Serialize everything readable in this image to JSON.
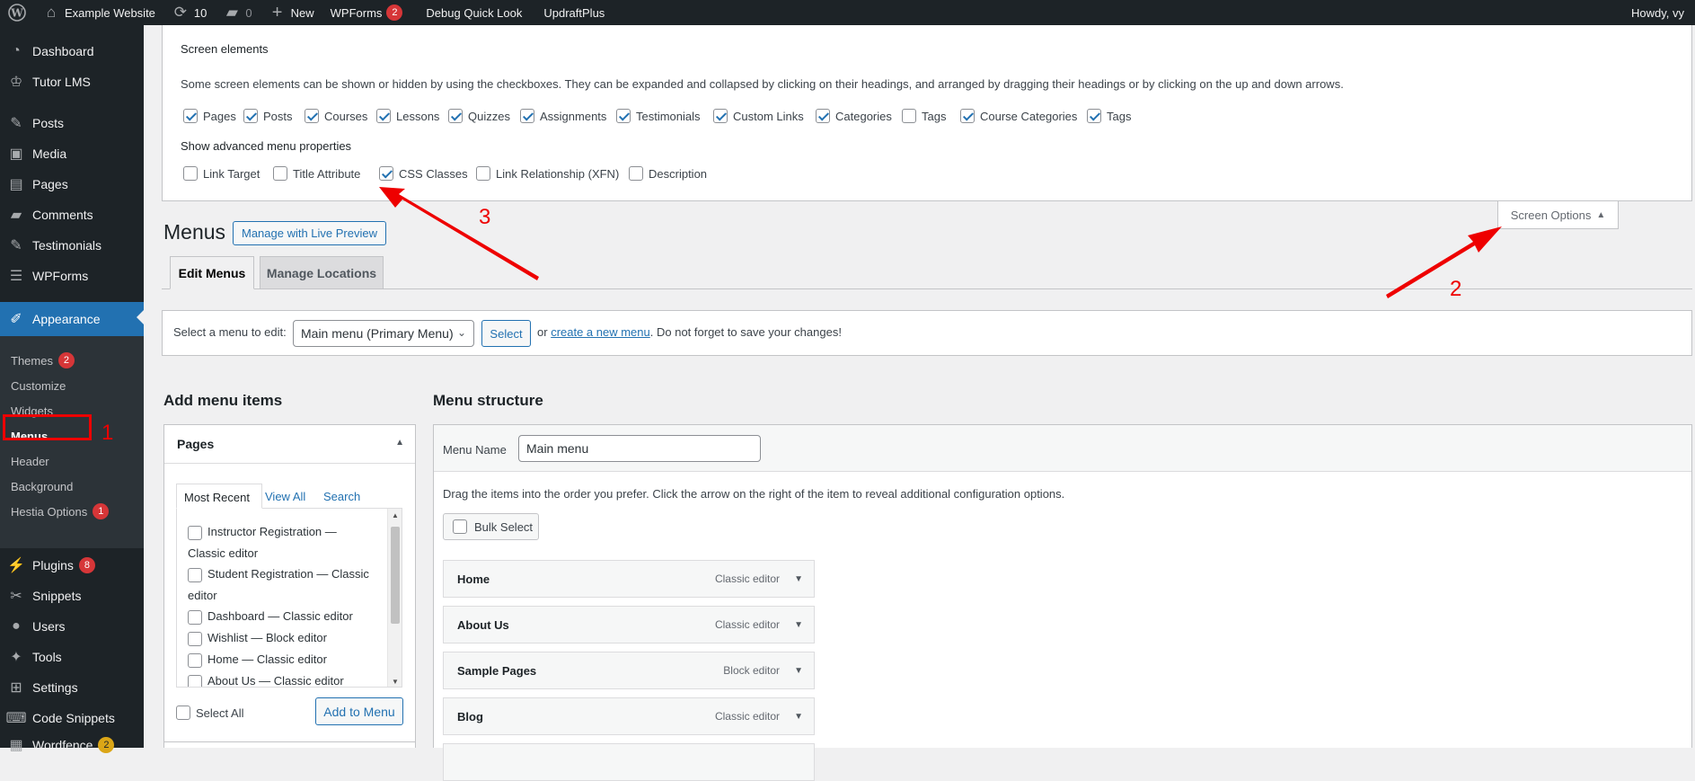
{
  "adminbar": {
    "site": "Example Website",
    "updates": "10",
    "comments": "0",
    "new": "New",
    "wpforms": "WPForms",
    "wpforms_badge": "2",
    "debug": "Debug Quick Look",
    "updraft": "UpdraftPlus",
    "howdy": "Howdy, vy"
  },
  "sidebar": {
    "items": [
      {
        "label": "Dashboard",
        "icon": "dashboard-icon"
      },
      {
        "label": "Tutor LMS",
        "icon": "graduation-cap-icon"
      },
      {
        "label": "Posts",
        "icon": "pin-icon"
      },
      {
        "label": "Media",
        "icon": "media-icon"
      },
      {
        "label": "Pages",
        "icon": "pages-icon"
      },
      {
        "label": "Comments",
        "icon": "comment-icon"
      },
      {
        "label": "Testimonials",
        "icon": "pin-icon"
      },
      {
        "label": "WPForms",
        "icon": "form-icon"
      },
      {
        "label": "Appearance",
        "icon": "brush-icon"
      },
      {
        "label": "Plugins",
        "icon": "plugin-icon",
        "badge": "8"
      },
      {
        "label": "Snippets",
        "icon": "snippets-icon"
      },
      {
        "label": "Users",
        "icon": "user-icon"
      },
      {
        "label": "Tools",
        "icon": "wrench-icon"
      },
      {
        "label": "Settings",
        "icon": "settings-icon"
      },
      {
        "label": "Code Snippets",
        "icon": "code-icon"
      },
      {
        "label": "Wordfence",
        "icon": "wordfence-icon",
        "badge": "2"
      }
    ],
    "sub": [
      {
        "label": "Themes",
        "badge": "2"
      },
      {
        "label": "Customize"
      },
      {
        "label": "Widgets"
      },
      {
        "label": "Menus"
      },
      {
        "label": "Header"
      },
      {
        "label": "Background"
      },
      {
        "label": "Hestia Options",
        "badge": "1"
      }
    ]
  },
  "annotations": {
    "n1": "1",
    "n2": "2",
    "n3": "3",
    "color": "#ee0000"
  },
  "screen_options": {
    "heading": "Screen elements",
    "desc": "Some screen elements can be shown or hidden by using the checkboxes. They can be expanded and collapsed by clicking on their headings, and arranged by dragging their headings or by clicking on the up and down arrows.",
    "elements": [
      {
        "label": "Pages",
        "checked": true
      },
      {
        "label": "Posts",
        "checked": true
      },
      {
        "label": "Courses",
        "checked": true
      },
      {
        "label": "Lessons",
        "checked": true
      },
      {
        "label": "Quizzes",
        "checked": true
      },
      {
        "label": "Assignments",
        "checked": true
      },
      {
        "label": "Testimonials",
        "checked": true
      },
      {
        "label": "Custom Links",
        "checked": true
      },
      {
        "label": "Categories",
        "checked": true
      },
      {
        "label": "Tags",
        "checked": false
      },
      {
        "label": "Course Categories",
        "checked": true
      },
      {
        "label": "Tags",
        "checked": true
      }
    ],
    "adv_heading": "Show advanced menu properties",
    "advanced": [
      {
        "label": "Link Target",
        "checked": false
      },
      {
        "label": "Title Attribute",
        "checked": false
      },
      {
        "label": "CSS Classes",
        "checked": true
      },
      {
        "label": "Link Relationship (XFN)",
        "checked": false
      },
      {
        "label": "Description",
        "checked": false
      }
    ],
    "toggle_label": "Screen Options",
    "toggle_arrow": "▲"
  },
  "page": {
    "title": "Menus",
    "live_preview": "Manage with Live Preview",
    "tab_edit": "Edit Menus",
    "tab_locations": "Manage Locations"
  },
  "select_bar": {
    "label": "Select a menu to edit:",
    "selected": "Main menu (Primary Menu)",
    "button": "Select",
    "or": "or",
    "create_link": "create a new menu",
    "tail": ". Do not forget to save your changes!"
  },
  "add_items": {
    "heading": "Add menu items",
    "box_title": "Pages",
    "tabs": [
      "Most Recent",
      "View All",
      "Search"
    ],
    "pages": [
      {
        "text": "Instructor Registration — Classic editor"
      },
      {
        "text": "Student Registration — Classic editor"
      },
      {
        "text": "Dashboard — Classic editor"
      },
      {
        "text": "Wishlist — Block editor"
      },
      {
        "text": "Home — Classic editor"
      },
      {
        "text": "About Us — Classic editor"
      }
    ],
    "select_all": "Select All",
    "add_button": "Add to Menu"
  },
  "structure": {
    "heading": "Menu structure",
    "name_label": "Menu Name",
    "name_value": "Main menu",
    "instructions": "Drag the items into the order you prefer. Click the arrow on the right of the item to reveal additional configuration options.",
    "bulk_select": "Bulk Select",
    "items": [
      {
        "title": "Home",
        "type": "Classic editor"
      },
      {
        "title": "About Us",
        "type": "Classic editor"
      },
      {
        "title": "Sample Pages",
        "type": "Block editor"
      },
      {
        "title": "Blog",
        "type": "Classic editor"
      }
    ]
  }
}
